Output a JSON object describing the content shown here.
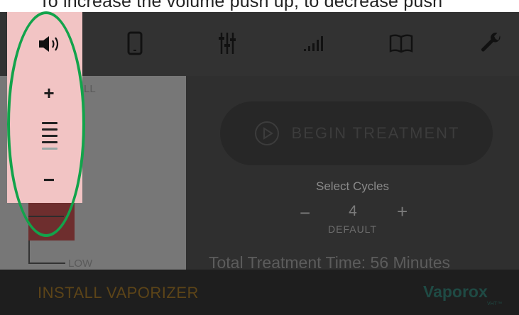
{
  "caption": "To increase the volume push up, to decrease push",
  "toolbar": {
    "icons": [
      "speaker-icon",
      "phone-icon",
      "sliders-icon",
      "signal-icon",
      "book-icon",
      "wrench-icon"
    ]
  },
  "volume": {
    "plus": "+",
    "minus": "−",
    "level_bars": 5,
    "active_bars": 4
  },
  "left_panel": {
    "top_label": "LL",
    "low_label": "LOW"
  },
  "treatment": {
    "begin_label": "BEGIN TREATMENT",
    "cycles_title": "Select Cycles",
    "minus": "−",
    "cycles_value": "4",
    "plus": "+",
    "default_label": "DEFAULT",
    "total_time": "Total Treatment Time: 56 Minutes"
  },
  "footer": {
    "install_label": "INSTALL VAPORIZER",
    "logo_text": "Vaporox",
    "logo_sub": "VHT™"
  },
  "colors": {
    "highlight": "#13a34b",
    "volume_panel": "#f2c4c4"
  }
}
